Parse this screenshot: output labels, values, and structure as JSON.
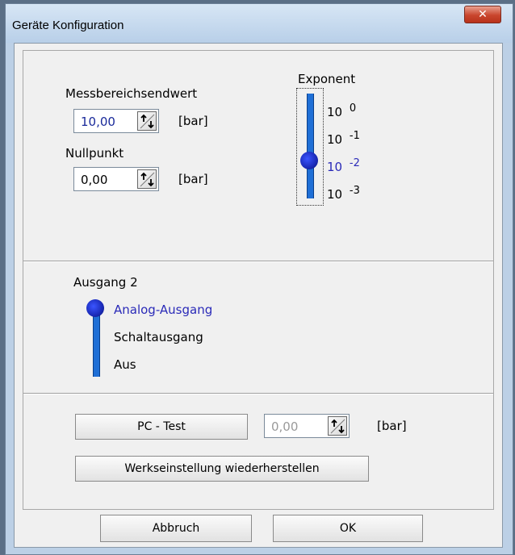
{
  "window": {
    "title": "Geräte Konfiguration"
  },
  "messbereich": {
    "label": "Messbereichsendwert",
    "value": "10,00",
    "unit": "[bar]"
  },
  "nullpunkt": {
    "label": "Nullpunkt",
    "value": "0,00",
    "unit": "[bar]"
  },
  "exponent": {
    "title": "Exponent",
    "options": [
      {
        "base": "10",
        "exp": "0"
      },
      {
        "base": "10",
        "exp": "-1"
      },
      {
        "base": "10",
        "exp": "-2"
      },
      {
        "base": "10",
        "exp": "-3"
      }
    ],
    "selected_index": 2
  },
  "ausgang": {
    "title": "Ausgang 2",
    "options": [
      "Analog-Ausgang",
      "Schaltausgang",
      "Aus"
    ],
    "selected_index": 0
  },
  "pc_test": {
    "button_label": "PC - Test",
    "value": "0,00",
    "unit": "[bar]"
  },
  "reset": {
    "button_label": "Werkseinstellung wiederherstellen"
  },
  "footer": {
    "cancel_label": "Abbruch",
    "ok_label": "OK"
  },
  "colors": {
    "accent": "#1a3bd0",
    "selected_text": "#2a2ab8",
    "slider_track": "#1f6fd6"
  }
}
